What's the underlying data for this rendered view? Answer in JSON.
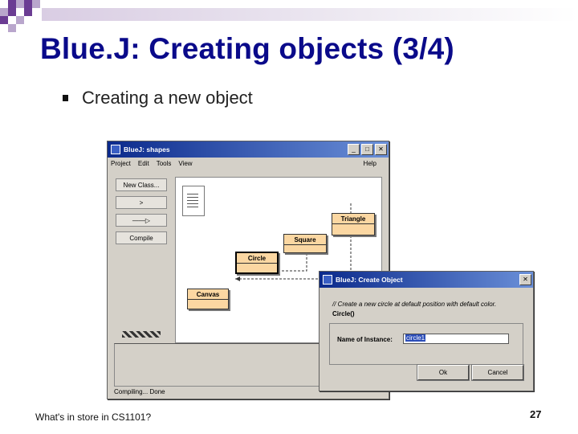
{
  "slide": {
    "title": "Blue.J: Creating objects (3/4)",
    "bullet": "Creating a new object",
    "footer_left": "What's in store in CS1101?",
    "page_number": "27"
  },
  "main_window": {
    "title": "BlueJ:  shapes",
    "menus": [
      "Project",
      "Edit",
      "Tools",
      "View"
    ],
    "help_menu": "Help",
    "toolbar": {
      "new_class": "New Class...",
      "dependency_arrow": ">",
      "inheritance_arrow": "——▷",
      "compile": "Compile"
    },
    "classes": {
      "triangle": "Triangle",
      "square": "Square",
      "circle": "Circle",
      "canvas": "Canvas"
    },
    "status": "Compiling... Done"
  },
  "dialog": {
    "title": "BlueJ:  Create Object",
    "comment": "// Create a new circle at default position with default color.",
    "signature": "Circle()",
    "instance_label": "Name of Instance:",
    "instance_value": "circle1",
    "ok_label": "Ok",
    "cancel_label": "Cancel"
  },
  "colors": {
    "title_blue": "#0a0a8a",
    "class_fill": "#fbd7a2",
    "window_titlebar": "#0b2a8c",
    "deco_purple": "#6b3c93"
  }
}
